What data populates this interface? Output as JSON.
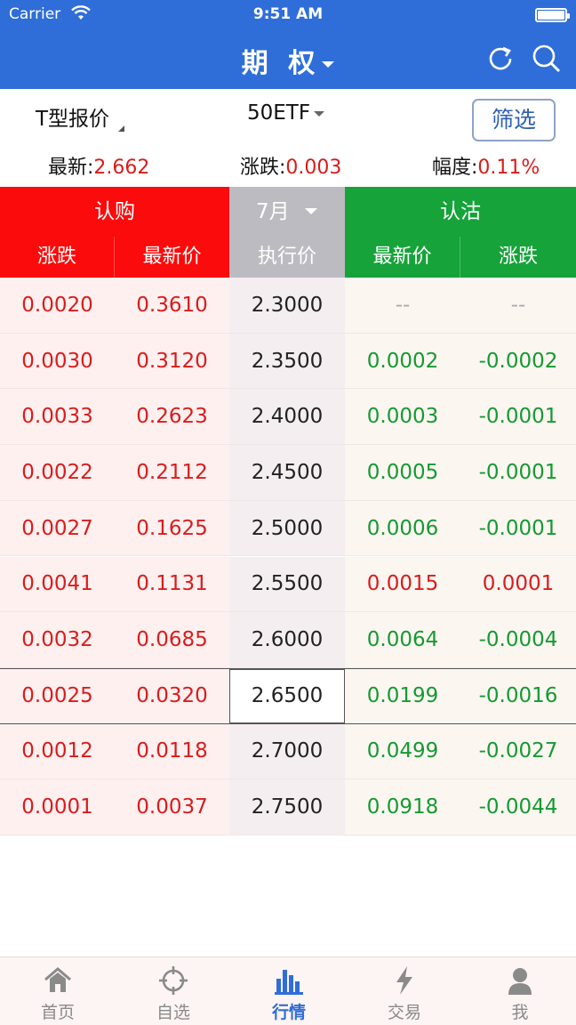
{
  "status": {
    "carrier": "Carrier",
    "time": "9:51 AM"
  },
  "nav": {
    "title": "期 权",
    "refresh_icon": "refresh-icon",
    "search_icon": "search-icon"
  },
  "selector": {
    "type_label": "T型报价",
    "underlying": "50ETF",
    "filter_label": "筛选"
  },
  "quote": {
    "last_label": "最新:",
    "last_value": "2.662",
    "change_label": "涨跌:",
    "change_value": "0.003",
    "range_label": "幅度:",
    "range_value": "0.11%"
  },
  "header": {
    "call": "认购",
    "call_change": "涨跌",
    "call_last": "最新价",
    "expiry": "7月",
    "strike": "执行价",
    "put": "认沽",
    "put_last": "最新价",
    "put_change": "涨跌"
  },
  "colors": {
    "brand": "#2f6ed8",
    "call": "#fb0b0b",
    "put": "#16a33a",
    "up": "#d91c1c",
    "down": "#159a32"
  },
  "rows": [
    {
      "call_change": "0.0020",
      "call_last": "0.3610",
      "strike": "2.3000",
      "put_last": "--",
      "put_change": "--",
      "put_last_color": "dash",
      "put_change_color": "dash"
    },
    {
      "call_change": "0.0030",
      "call_last": "0.3120",
      "strike": "2.3500",
      "put_last": "0.0002",
      "put_change": "-0.0002",
      "put_last_color": "green",
      "put_change_color": "green"
    },
    {
      "call_change": "0.0033",
      "call_last": "0.2623",
      "strike": "2.4000",
      "put_last": "0.0003",
      "put_change": "-0.0001",
      "put_last_color": "green",
      "put_change_color": "green"
    },
    {
      "call_change": "0.0022",
      "call_last": "0.2112",
      "strike": "2.4500",
      "put_last": "0.0005",
      "put_change": "-0.0001",
      "put_last_color": "green",
      "put_change_color": "green"
    },
    {
      "call_change": "0.0027",
      "call_last": "0.1625",
      "strike": "2.5000",
      "put_last": "0.0006",
      "put_change": "-0.0001",
      "put_last_color": "green",
      "put_change_color": "green"
    },
    {
      "call_change": "0.0041",
      "call_last": "0.1131",
      "strike": "2.5500",
      "put_last": "0.0015",
      "put_change": "0.0001",
      "put_last_color": "red",
      "put_change_color": "red"
    },
    {
      "call_change": "0.0032",
      "call_last": "0.0685",
      "strike": "2.6000",
      "put_last": "0.0064",
      "put_change": "-0.0004",
      "put_last_color": "green",
      "put_change_color": "green"
    },
    {
      "call_change": "0.0025",
      "call_last": "0.0320",
      "strike": "2.6500",
      "put_last": "0.0199",
      "put_change": "-0.0016",
      "put_last_color": "green",
      "put_change_color": "green",
      "atm": true
    },
    {
      "call_change": "0.0012",
      "call_last": "0.0118",
      "strike": "2.7000",
      "put_last": "0.0499",
      "put_change": "-0.0027",
      "put_last_color": "green",
      "put_change_color": "green"
    },
    {
      "call_change": "0.0001",
      "call_last": "0.0037",
      "strike": "2.7500",
      "put_last": "0.0918",
      "put_change": "-0.0044",
      "put_last_color": "green",
      "put_change_color": "green"
    }
  ],
  "tabs": [
    {
      "label": "首页",
      "icon": "home-icon"
    },
    {
      "label": "自选",
      "icon": "crosshair-icon"
    },
    {
      "label": "行情",
      "icon": "bar-chart-icon",
      "active": true
    },
    {
      "label": "交易",
      "icon": "lightning-icon"
    },
    {
      "label": "我",
      "icon": "user-icon"
    }
  ]
}
